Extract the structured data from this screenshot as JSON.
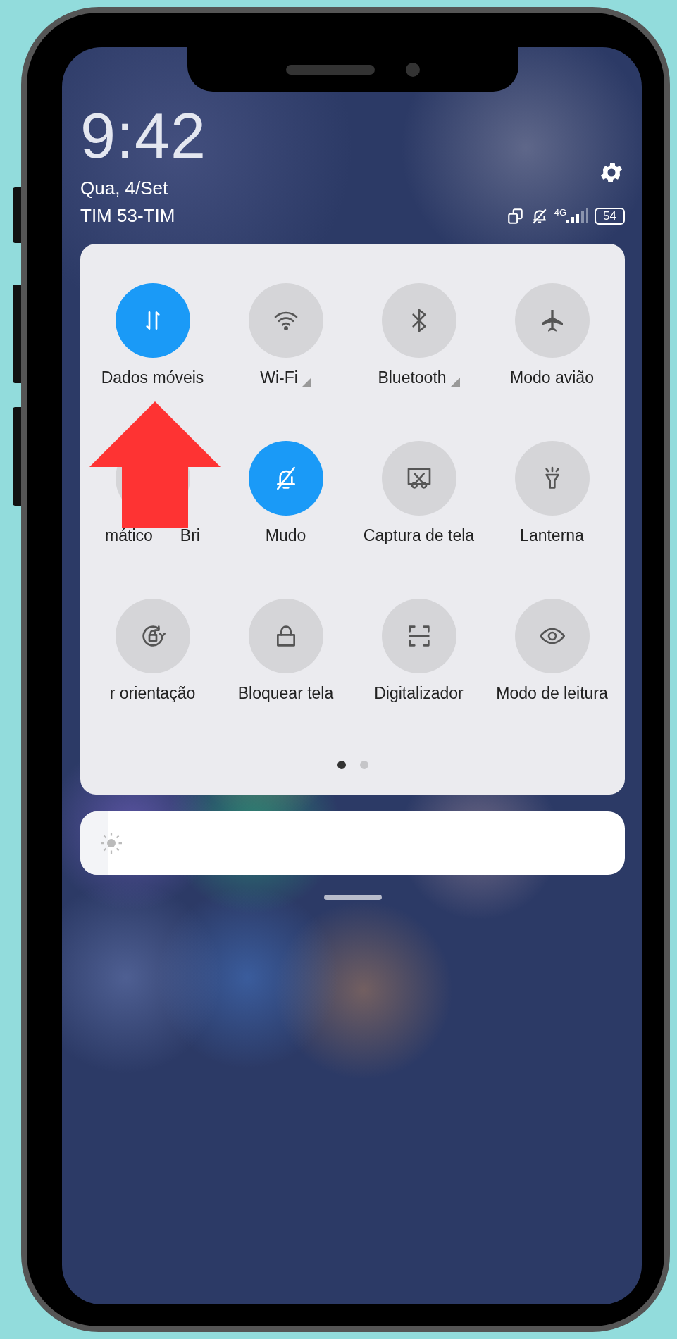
{
  "clock": {
    "time": "9:42",
    "date": "Qua, 4/Set",
    "carrier": "TIM 53-TIM"
  },
  "status_bar": {
    "network": "4G",
    "battery": "54"
  },
  "tiles": [
    {
      "label": "Dados móveis",
      "on": true,
      "has_more": false
    },
    {
      "label": "Wi-Fi",
      "on": false,
      "has_more": true
    },
    {
      "label": "Bluetooth",
      "on": false,
      "has_more": true
    },
    {
      "label": "Modo avião",
      "on": false,
      "has_more": false
    },
    {
      "label": "mático",
      "label_2": "Bri",
      "on": false,
      "has_more": false
    },
    {
      "label": "Mudo",
      "on": true,
      "has_more": false
    },
    {
      "label": "Captura de tela",
      "on": false,
      "has_more": false
    },
    {
      "label": "Lanterna",
      "on": false,
      "has_more": false
    },
    {
      "label": "r orientação",
      "on": false,
      "has_more": false
    },
    {
      "label": "Bloquear tela",
      "on": false,
      "has_more": false
    },
    {
      "label": "Digitalizador",
      "on": false,
      "has_more": false
    },
    {
      "label": "Modo de leitura",
      "on": false,
      "has_more": false
    }
  ],
  "pages": [
    {
      "selected": true
    },
    {
      "selected": false
    }
  ],
  "brightness": {
    "level": 0.05
  }
}
